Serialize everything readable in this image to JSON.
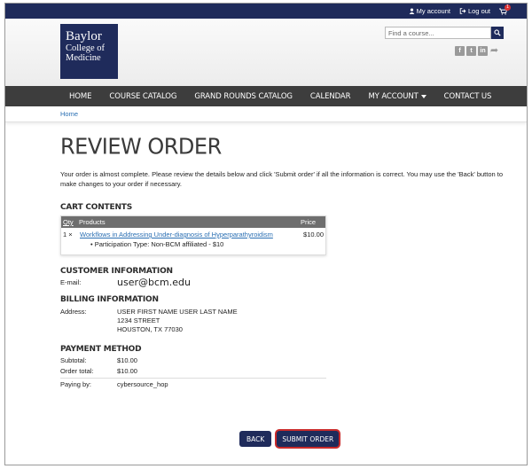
{
  "topbar": {
    "my_account": "My account",
    "log_out": "Log out",
    "cart_count": "1"
  },
  "header": {
    "logo_line1": "Baylor",
    "logo_line2": "College of",
    "logo_line3": "Medicine",
    "search_placeholder": "Find a course...",
    "social_icons": [
      "facebook-icon",
      "twitter-icon",
      "linkedin-icon",
      "share-icon"
    ]
  },
  "nav": {
    "items": [
      "HOME",
      "COURSE CATALOG",
      "GRAND ROUNDS CATALOG",
      "CALENDAR",
      "MY ACCOUNT",
      "CONTACT US"
    ]
  },
  "breadcrumb": {
    "home": "Home"
  },
  "page": {
    "title": "REVIEW ORDER",
    "intro": "Your order is almost complete. Please review the details below and click 'Submit order' if all the information is correct. You may use the 'Back' button to make changes to your order if necessary."
  },
  "cart": {
    "section_title": "CART CONTENTS",
    "headers": {
      "qty": "Qty",
      "products": "Products",
      "price": "Price"
    },
    "rows": [
      {
        "qty": "1 ×",
        "product": "Workflows in Addressing Under-diagnosis of Hyperparathyroidism",
        "attribute": "Participation Type: Non-BCM affiliated - $10",
        "price": "$10.00"
      }
    ]
  },
  "customer": {
    "section_title": "CUSTOMER INFORMATION",
    "email_label": "E-mail:",
    "email_value": "user@bcm.edu"
  },
  "billing": {
    "section_title": "BILLING INFORMATION",
    "address_label": "Address:",
    "address_lines": [
      "USER FIRST NAME USER LAST NAME",
      "1234 STREET",
      "HOUSTON, TX 77030"
    ]
  },
  "payment": {
    "section_title": "PAYMENT METHOD",
    "subtotal_label": "Subtotal:",
    "subtotal_value": "$10.00",
    "order_total_label": "Order total:",
    "order_total_value": "$10.00",
    "paying_by_label": "Paying by:",
    "paying_by_value": "cybersource_hop"
  },
  "actions": {
    "back": "BACK",
    "submit": "SUBMIT ORDER"
  },
  "colors": {
    "brand_navy": "#1f2b5b",
    "nav_gray": "#3d3d3d",
    "link_blue": "#2a6fb3",
    "submit_outline": "#c92a2a"
  }
}
